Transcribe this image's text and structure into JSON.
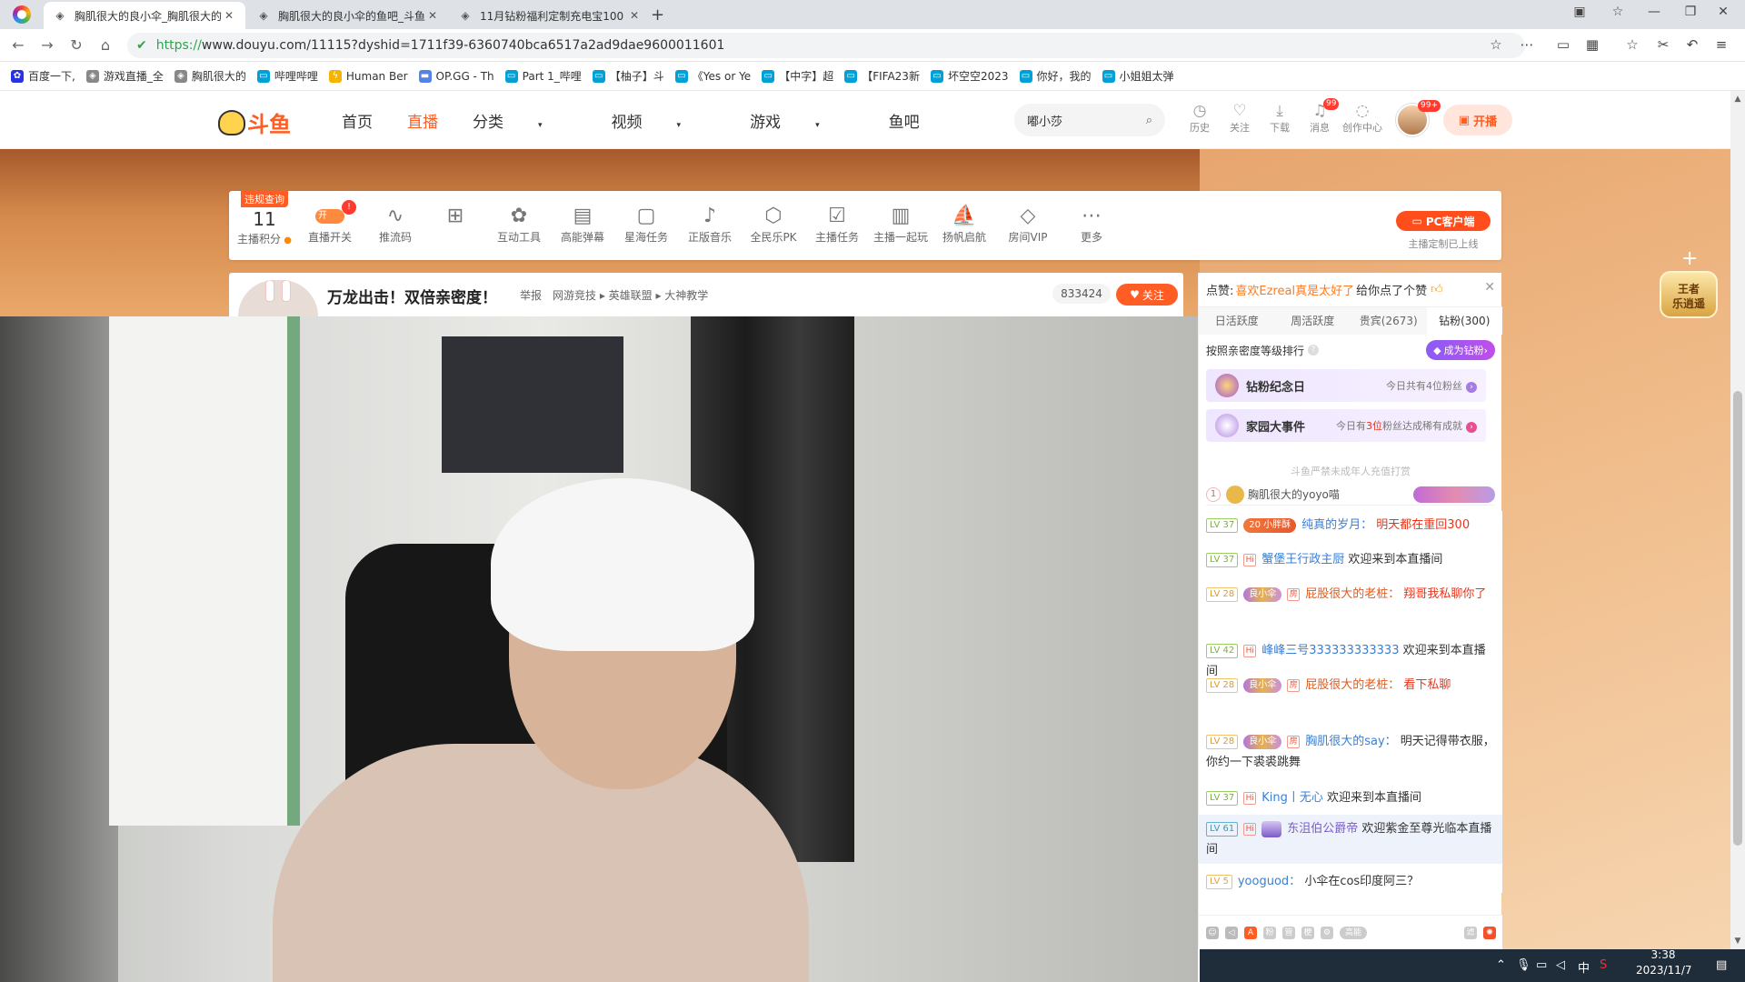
{
  "browser": {
    "tabs": [
      {
        "title": "胸肌很大的良小伞_胸肌很大的",
        "active": true
      },
      {
        "title": "胸肌很大的良小伞的鱼吧_斗鱼",
        "active": false
      },
      {
        "title": "11月钻粉福利定制充电宝100",
        "active": false
      }
    ],
    "url_proto": "https://",
    "url_rest": "www.douyu.com/11115?dyshid=1711f39-6360740bca6517a2ad9dae9600011601",
    "bookmarks": [
      "百度一下,",
      "游戏直播_全",
      "胸肌很大的",
      "哔哩哔哩",
      "Human Ber",
      "OP.GG - Th",
      "Part 1_哔哩",
      "【柚子】斗",
      "《Yes or Ye",
      "【中字】超",
      "【FIFA23新",
      "坏空空2023",
      "你好，我的",
      "小姐姐太弹"
    ]
  },
  "site": {
    "logo": "斗鱼",
    "nav": [
      "首页",
      "直播",
      "分类",
      "视频",
      "游戏",
      "鱼吧"
    ],
    "nav_active": "直播",
    "search_value": "嘟小莎",
    "header_icons": [
      {
        "label": "历史",
        "icon": "clock-icon"
      },
      {
        "label": "关注",
        "icon": "heart-icon"
      },
      {
        "label": "下载",
        "icon": "download-icon"
      },
      {
        "label": "消息",
        "icon": "bell-icon",
        "badge": "99"
      },
      {
        "label": "创作中心",
        "icon": "bulb-icon"
      }
    ],
    "avatar_badge": "99+",
    "start_live": "开播"
  },
  "toolbar": {
    "violation_tag": "违规查询",
    "score_value": "11",
    "score_label": "主播积分",
    "switch_label": "直播开关",
    "switch_state": "开",
    "items": [
      {
        "label": "推流码",
        "icon": "waveform-icon"
      },
      {
        "label": "",
        "icon": "gift-icon"
      },
      {
        "label": "互动工具",
        "icon": "interact-icon"
      },
      {
        "label": "高能弹幕",
        "icon": "danmaku-icon"
      },
      {
        "label": "星海任务",
        "icon": "ad-icon"
      },
      {
        "label": "正版音乐",
        "icon": "music-icon"
      },
      {
        "label": "全民乐PK",
        "icon": "pk-icon"
      },
      {
        "label": "主播任务",
        "icon": "task-icon"
      },
      {
        "label": "主播一起玩",
        "icon": "clipboard-icon"
      },
      {
        "label": "扬帆启航",
        "icon": "sail-icon"
      },
      {
        "label": "房间VIP",
        "icon": "diamond-icon"
      },
      {
        "label": "更多",
        "icon": "more-icon"
      }
    ],
    "pc_client": "PC客户端",
    "pc_note": "主播定制已上线"
  },
  "room": {
    "title": "万龙出击！双倍亲密度！",
    "report": "举报",
    "breadcrumb": "网游竞技 ▸ 英雄联盟 ▸ 大神教学",
    "heat": "833424",
    "follow": "关注"
  },
  "chat": {
    "like_prefix": "点赞:",
    "like_user": "喜欢Ezreal真是太好了",
    "like_suffix": "给你点了个赞",
    "rank_tabs": [
      "日活跃度",
      "周活跃度",
      "贵宾(2673)",
      "钻粉(300)"
    ],
    "rank_tab_active": "钻粉(300)",
    "rank_head": "按照亲密度等级排行",
    "become_fan": "成为钻粉",
    "promo1_title": "钻粉纪念日",
    "promo1_text": "今日共有4位粉丝",
    "promo2_title": "家园大事件",
    "promo2_text_a": "今日有",
    "promo2_red": "3位",
    "promo2_text_b": "粉丝达成稀有成就",
    "notice": "斗鱼严禁未成年人充值打赏",
    "rank1_num": "1",
    "rank1_name": "胸肌很大的yoyo喵",
    "messages": [
      {
        "lv": "LV 37",
        "badge": "20 小胖酥",
        "name": "纯真的岁月：",
        "text": "明天都在重回300",
        "text_red": true
      },
      {
        "lv": "LV 37",
        "hi": "Hi",
        "name": "蟹堡王行政主厨",
        "text": "欢迎来到本直播间"
      },
      {
        "lv": "LV 28",
        "badge": "良小伞",
        "room": "房",
        "name": "屁股很大的老桩：",
        "text": "翔哥我私聊你了",
        "text_red": true
      },
      {
        "lv": "LV 42",
        "hi": "Hi",
        "name": "峰峰三号333333333333",
        "text": "欢迎来到本直播间"
      },
      {
        "lv": "LV 28",
        "badge": "良小伞",
        "room": "房",
        "name": "屁股很大的老桩：",
        "text": "看下私聊",
        "text_red": true
      },
      {
        "lv": "LV 28",
        "badge": "良小伞",
        "room": "房",
        "name": "胸肌很大的say：",
        "text": "明天记得带衣服，你约一下裘裘跳舞"
      },
      {
        "lv": "LV 37",
        "hi": "Hi",
        "name": "King丨无心",
        "text": "欢迎来到本直播间"
      },
      {
        "lv": "LV 61",
        "hi": "Hi",
        "name": "东沮伯公爵帝",
        "text": "欢迎紫金至尊光临本直播间"
      },
      {
        "lv": "LV 5",
        "name": "yooguod：",
        "text": "小伞在cos印度阿三？"
      }
    ]
  },
  "side": {
    "king_badge_line1": "王者",
    "king_badge_line2": "乐逍遥"
  },
  "taskbar": {
    "ime": "中",
    "time": "3:38",
    "date": "2023/11/7"
  }
}
